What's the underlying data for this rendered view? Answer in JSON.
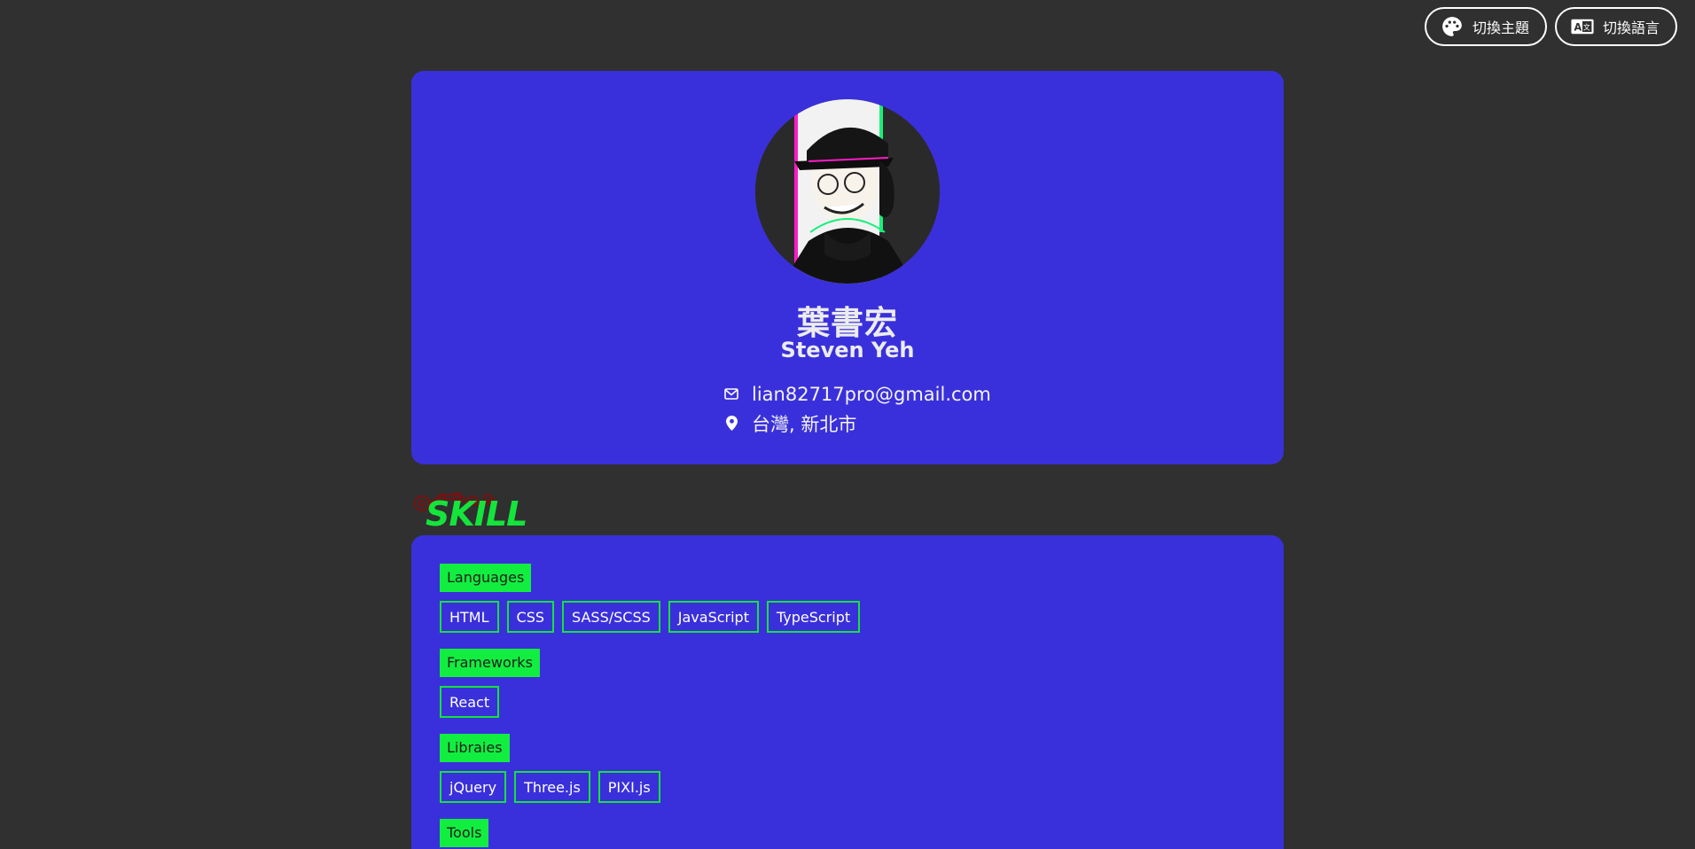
{
  "top_actions": {
    "theme_label": "切換主題",
    "language_label": "切換語言"
  },
  "profile": {
    "name_zh": "葉書宏",
    "name_en": "Steven Yeh",
    "email": "lian82717pro@gmail.com",
    "location": "台灣, 新北市"
  },
  "skill_section": {
    "title": "SKILL",
    "groups": [
      {
        "label": "Languages",
        "tags": [
          "HTML",
          "CSS",
          "SASS/SCSS",
          "JavaScript",
          "TypeScript"
        ]
      },
      {
        "label": "Frameworks",
        "tags": [
          "React"
        ]
      },
      {
        "label": "Libraies",
        "tags": [
          "jQuery",
          "Three.js",
          "PIXI.js"
        ]
      },
      {
        "label": "Tools",
        "tags": []
      }
    ]
  },
  "colors": {
    "background": "#303030",
    "card": "#3a30db",
    "accent_green": "#12ee3f"
  },
  "icons": {
    "theme": "palette-icon",
    "language": "translate-icon",
    "email": "envelope-icon",
    "location": "map-pin-icon"
  }
}
